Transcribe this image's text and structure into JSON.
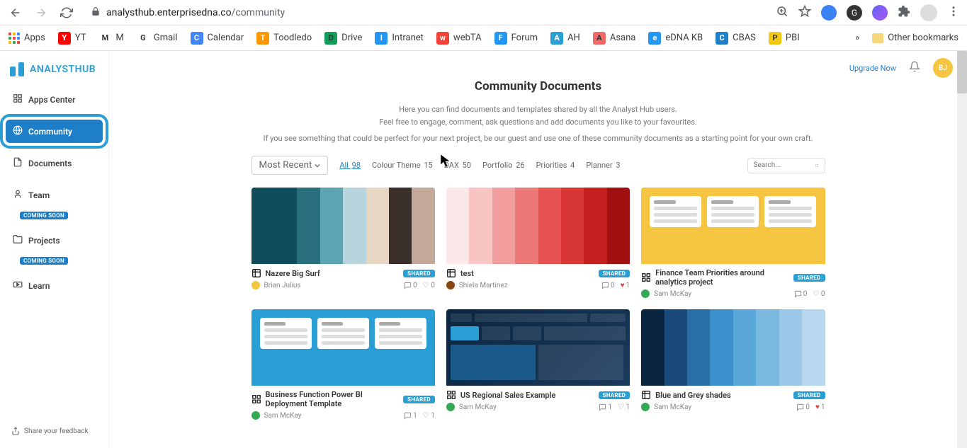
{
  "browser": {
    "url_host": "analysthub.enterprisedna.co",
    "url_path": "/community"
  },
  "bookmarks": [
    {
      "label": "Apps",
      "icon": "apps"
    },
    {
      "label": "YT",
      "icon": "yt",
      "bg": "#ff0000",
      "fg": "#fff"
    },
    {
      "label": "M",
      "icon": "gmail",
      "bg": "#fff"
    },
    {
      "label": "Gmail",
      "icon": "gmail2",
      "bg": "#fff"
    },
    {
      "label": "Calendar",
      "icon": "cal",
      "bg": "#4285f4",
      "fg": "#fff"
    },
    {
      "label": "Toodledo",
      "icon": "check",
      "bg": "#ff9800",
      "fg": "#fff"
    },
    {
      "label": "Drive",
      "icon": "drive",
      "bg": "#0f9d58"
    },
    {
      "label": "Intranet",
      "icon": "intra",
      "bg": "#2196f3",
      "fg": "#fff"
    },
    {
      "label": "webTA",
      "icon": "webta",
      "bg": "#f44336",
      "fg": "#fff"
    },
    {
      "label": "Forum",
      "icon": "forum",
      "bg": "#2196f3",
      "fg": "#fff"
    },
    {
      "label": "AH",
      "icon": "ah",
      "bg": "#2a9fd6",
      "fg": "#fff"
    },
    {
      "label": "Asana",
      "icon": "asana",
      "bg": "#f06a6a"
    },
    {
      "label": "eDNA KB",
      "icon": "edna",
      "bg": "#2196f3",
      "fg": "#fff"
    },
    {
      "label": "CBAS",
      "icon": "cbas",
      "bg": "#1e7fc8",
      "fg": "#fff"
    },
    {
      "label": "PBI",
      "icon": "pbi",
      "bg": "#f2c811"
    }
  ],
  "bookmarks_more": "»",
  "other_bookmarks": "Other bookmarks",
  "app": {
    "logo": "ANALYSTHUB",
    "upgrade": "Upgrade Now",
    "avatar_initials": "BJ"
  },
  "sidebar": [
    {
      "label": "Apps Center",
      "icon": "grid"
    },
    {
      "label": "Community",
      "icon": "globe",
      "active": true
    },
    {
      "label": "Documents",
      "icon": "doc"
    },
    {
      "label": "Team",
      "icon": "team",
      "soon": "COMING SOON"
    },
    {
      "label": "Projects",
      "icon": "folder",
      "soon": "COMING SOON"
    },
    {
      "label": "Learn",
      "icon": "play"
    }
  ],
  "feedback": "Share your feedback",
  "page": {
    "title": "Community Documents",
    "desc1": "Here you can find documents and templates shared by all the Analyst Hub users.",
    "desc2": "Feel free to engage, comment, ask questions and add documents you like to your favourites.",
    "desc3": "If you see something that could be perfect for your next project, be our guest and use one of these community documents as a starting point for your own craft."
  },
  "filters": {
    "sort": "Most Recent",
    "tabs": [
      {
        "label": "All",
        "count": "98",
        "active": true
      },
      {
        "label": "Colour Theme",
        "count": "15"
      },
      {
        "label": "DAX",
        "count": "50"
      },
      {
        "label": "Portfolio",
        "count": "26"
      },
      {
        "label": "Priorities",
        "count": "4"
      },
      {
        "label": "Planner",
        "count": "3"
      }
    ],
    "search_placeholder": "Search..."
  },
  "cards": [
    {
      "title": "Nazere Big Surf",
      "author": "Brian Julius",
      "author_color": "#f5c542",
      "shared": "SHARED",
      "type": "palette",
      "comments": "0",
      "likes": "0",
      "liked": false,
      "colors": [
        "#0f4c5c",
        "#0f4c5c",
        "#2a6f7e",
        "#5ba5b3",
        "#b8d4dc",
        "#e8d6c4",
        "#3a2f2a",
        "#c4a89a"
      ]
    },
    {
      "title": "test",
      "author": "Shiela Martinez",
      "author_color": "#8b4513",
      "shared": "SHARED",
      "type": "palette",
      "comments": "0",
      "likes": "1",
      "liked": true,
      "colors": [
        "#fce8e8",
        "#f8c4c4",
        "#f29e9e",
        "#ec7878",
        "#e65252",
        "#d93636",
        "#c42020",
        "#a01010"
      ]
    },
    {
      "title": "Finance Team Priorities around analytics project",
      "author": "Sam McKay",
      "author_color": "#34a853",
      "shared": "SHARED",
      "type": "wireframe",
      "bg": "#f5c542",
      "comments": "0",
      "likes": "0",
      "liked": false
    },
    {
      "title": "Business Function Power BI Deployment Template",
      "author": "Sam McKay",
      "author_color": "#34a853",
      "shared": "SHARED",
      "type": "wireframe",
      "bg": "#2a9fd6",
      "comments": "1",
      "likes": "1",
      "liked": false
    },
    {
      "title": "US Regional Sales Example",
      "author": "Sam McKay",
      "author_color": "#34a853",
      "shared": "SHARED",
      "type": "dashboard",
      "comments": "1",
      "likes": "1",
      "liked": false
    },
    {
      "title": "Blue and Grey shades",
      "author": "Sam McKay",
      "author_color": "#34a853",
      "shared": "SHARED",
      "type": "palette",
      "comments": "0",
      "likes": "1",
      "liked": true,
      "colors": [
        "#0a2540",
        "#1a4a7a",
        "#2a6fa5",
        "#3a8fcc",
        "#5aa8d9",
        "#7ab8e0",
        "#9ac8e8",
        "#b8d8f0"
      ]
    }
  ]
}
